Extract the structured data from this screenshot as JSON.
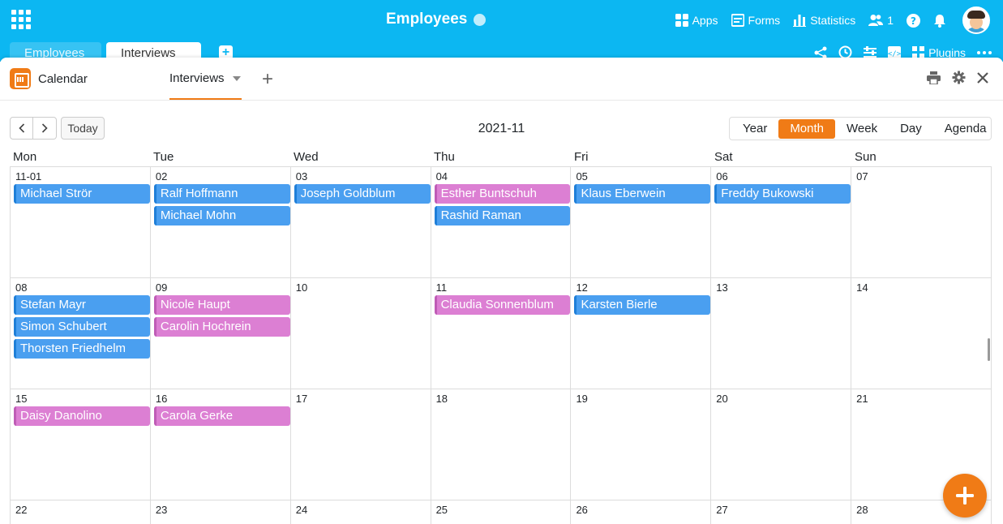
{
  "app": {
    "title": "Employees",
    "actions": [
      {
        "label": "Apps",
        "icon": "apps-icon"
      },
      {
        "label": "Forms",
        "icon": "forms-icon"
      },
      {
        "label": "Statistics",
        "icon": "statistics-icon"
      }
    ],
    "collaborators_count": "1"
  },
  "table_tabs": {
    "inactive": "Employees",
    "active": "Interviews"
  },
  "toolbar": {
    "plugins_label": "Plugins"
  },
  "plugin": {
    "name": "Calendar",
    "view_name": "Interviews"
  },
  "calendar": {
    "today_label": "Today",
    "current_month": "2021-11",
    "views": [
      "Year",
      "Month",
      "Week",
      "Day",
      "Agenda"
    ],
    "active_view": "Month",
    "weekdays": [
      "Mon",
      "Tue",
      "Wed",
      "Thu",
      "Fri",
      "Sat",
      "Sun"
    ],
    "colors": {
      "blue": "#4a9ff0",
      "pink": "#dc7fd3",
      "accent": "#f07b16"
    },
    "weeks": [
      {
        "days": [
          {
            "label": "11-01",
            "events": [
              {
                "name": "Michael Strör",
                "color": "blue"
              }
            ]
          },
          {
            "label": "02",
            "events": [
              {
                "name": "Ralf Hoffmann",
                "color": "blue"
              },
              {
                "name": "Michael Mohn",
                "color": "blue"
              }
            ]
          },
          {
            "label": "03",
            "events": [
              {
                "name": "Joseph Goldblum",
                "color": "blue"
              }
            ]
          },
          {
            "label": "04",
            "events": [
              {
                "name": "Esther Buntschuh",
                "color": "pink"
              },
              {
                "name": "Rashid Raman",
                "color": "blue"
              }
            ]
          },
          {
            "label": "05",
            "events": [
              {
                "name": "Klaus Eberwein",
                "color": "blue"
              }
            ]
          },
          {
            "label": "06",
            "events": [
              {
                "name": "Freddy Bukowski",
                "color": "blue"
              }
            ]
          },
          {
            "label": "07",
            "events": []
          }
        ]
      },
      {
        "days": [
          {
            "label": "08",
            "events": [
              {
                "name": "Stefan Mayr",
                "color": "blue"
              },
              {
                "name": "Simon Schubert",
                "color": "blue"
              },
              {
                "name": "Thorsten Friedhelm",
                "color": "blue"
              }
            ]
          },
          {
            "label": "09",
            "events": [
              {
                "name": "Nicole Haupt",
                "color": "pink"
              },
              {
                "name": "Carolin Hochrein",
                "color": "pink"
              }
            ]
          },
          {
            "label": "10",
            "events": []
          },
          {
            "label": "11",
            "events": [
              {
                "name": "Claudia Sonnenblum",
                "color": "pink"
              }
            ]
          },
          {
            "label": "12",
            "events": [
              {
                "name": "Karsten Bierle",
                "color": "blue"
              }
            ]
          },
          {
            "label": "13",
            "events": []
          },
          {
            "label": "14",
            "events": []
          }
        ]
      },
      {
        "days": [
          {
            "label": "15",
            "events": [
              {
                "name": "Daisy Danolino",
                "color": "pink"
              }
            ]
          },
          {
            "label": "16",
            "events": [
              {
                "name": "Carola Gerke",
                "color": "pink"
              }
            ]
          },
          {
            "label": "17",
            "events": []
          },
          {
            "label": "18",
            "events": []
          },
          {
            "label": "19",
            "events": []
          },
          {
            "label": "20",
            "events": []
          },
          {
            "label": "21",
            "events": []
          }
        ]
      },
      {
        "days": [
          {
            "label": "22",
            "events": []
          },
          {
            "label": "23",
            "events": []
          },
          {
            "label": "24",
            "events": []
          },
          {
            "label": "25",
            "events": []
          },
          {
            "label": "26",
            "events": []
          },
          {
            "label": "27",
            "events": []
          },
          {
            "label": "28",
            "events": []
          }
        ]
      }
    ]
  }
}
